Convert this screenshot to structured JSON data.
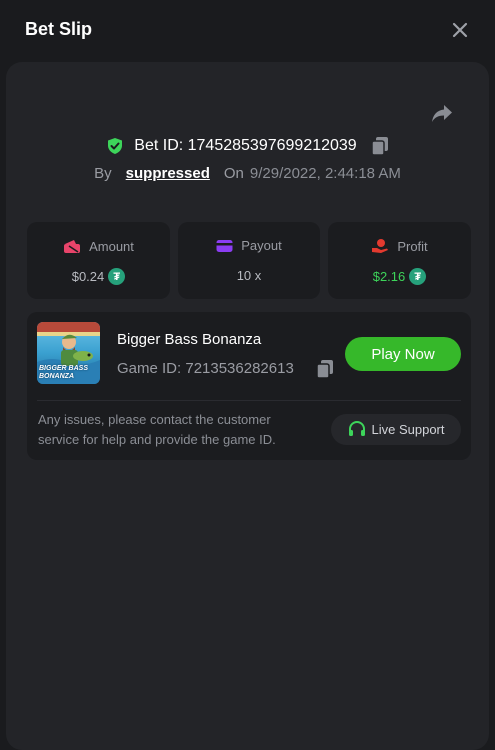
{
  "modal": {
    "title": "Bet Slip",
    "close_icon": "close-icon",
    "share_icon": "share-icon"
  },
  "bet": {
    "id_label": "Bet ID: 1745285397699212039",
    "by_label": "By",
    "user": "suppressed",
    "on_label": "On",
    "datetime": "9/29/2022, 2:44:18 AM",
    "verified_icon": "shield-check-icon",
    "copy_icon": "copy-icon"
  },
  "stats": [
    {
      "label": "Amount",
      "value": "$0.24",
      "icon": "wallet-icon",
      "icon_color": "#e8446a",
      "currency_icon": "tether-icon"
    },
    {
      "label": "Payout",
      "value": "10 x",
      "icon": "card-icon",
      "icon_color": "#8b3df2"
    },
    {
      "label": "Profit",
      "value": "$2.16",
      "icon": "hand-coin-icon",
      "icon_color": "#e33a2f",
      "currency_icon": "tether-icon",
      "value_color": "#3dd45a"
    }
  ],
  "game": {
    "name": "Bigger Bass Bonanza",
    "id_label": "Game ID: 7213536282613",
    "thumb_text": "BIGGER BASS BONANZA",
    "play_label": "Play Now",
    "notice": "Any issues, please contact the customer service for help and provide the game ID.",
    "support_label": "Live Support",
    "support_icon": "headset-icon"
  },
  "colors": {
    "accent_green": "#36b82a",
    "panel": "#232428",
    "card": "#1b1c1f"
  }
}
